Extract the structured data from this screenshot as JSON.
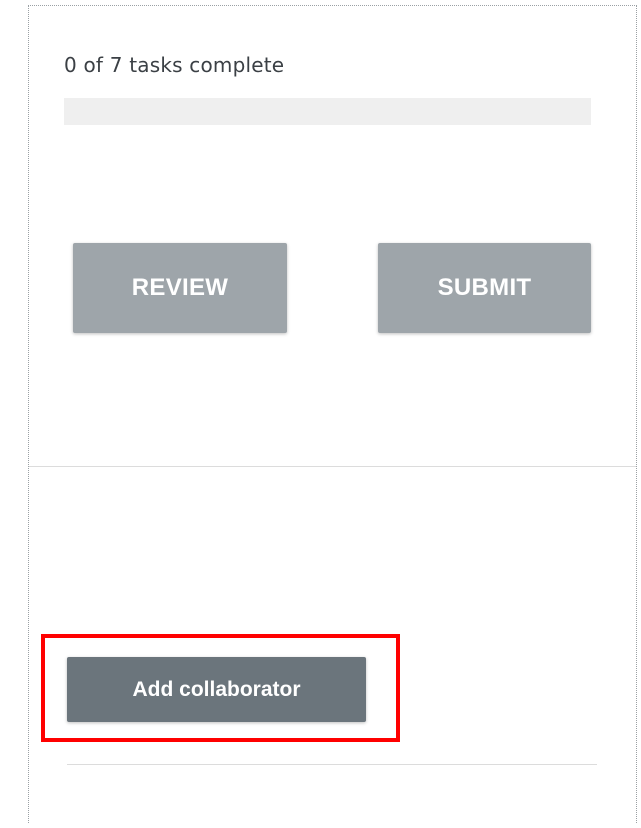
{
  "progress": {
    "label": "0 of 7 tasks complete",
    "completed": 0,
    "total": 7,
    "fraction": 0
  },
  "actions": {
    "review_label": "REVIEW",
    "submit_label": "SUBMIT"
  },
  "collaborators": {
    "add_label": "Add collaborator"
  },
  "colors": {
    "button_disabled": "#9ea5aa",
    "button_secondary": "#6b757c",
    "progress_track": "#efefef",
    "highlight": "#ff0000"
  }
}
